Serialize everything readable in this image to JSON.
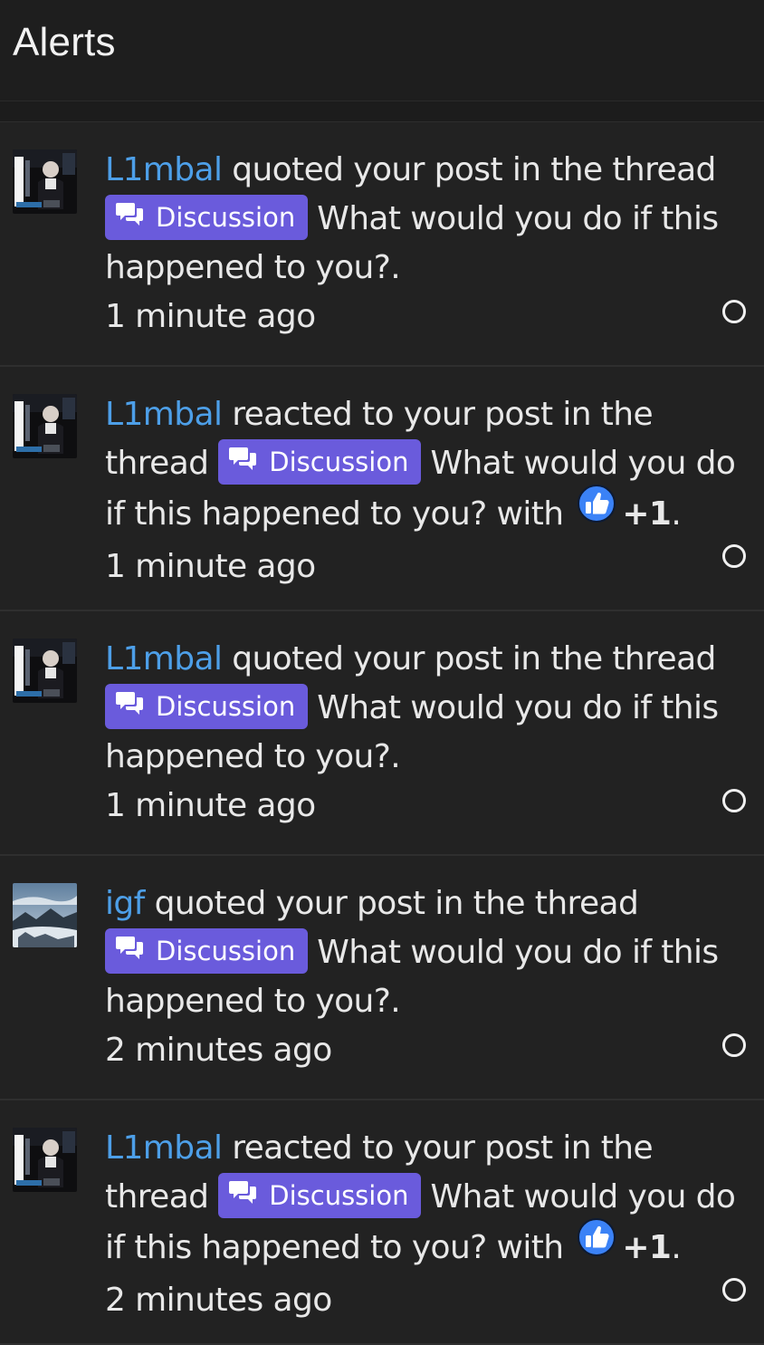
{
  "header": {
    "title": "Alerts"
  },
  "alerts": [
    {
      "user": "L1mbal",
      "action": "quoted your post in the thread",
      "prefix": "Discussion",
      "thread_title": "What would you do if this happened to you?",
      "reaction": "",
      "time": "1 minute ago",
      "avatar": "portrait"
    },
    {
      "user": "L1mbal",
      "action": "reacted to your post in the thread",
      "prefix": "Discussion",
      "thread_title": "What would you do if this happened to you?",
      "reaction": "+1",
      "time": "1 minute ago",
      "avatar": "portrait"
    },
    {
      "user": "L1mbal",
      "action": "quoted your post in the thread",
      "prefix": "Discussion",
      "thread_title": "What would you do if this happened to you?",
      "reaction": "",
      "time": "1 minute ago",
      "avatar": "portrait"
    },
    {
      "user": "igf",
      "action": "quoted your post in the thread",
      "prefix": "Discussion",
      "thread_title": "What would you do if this happened to you?",
      "reaction": "",
      "time": "2 minutes ago",
      "avatar": "landscape"
    },
    {
      "user": "L1mbal",
      "action": "reacted to your post in the thread",
      "prefix": "Discussion",
      "thread_title": "What would you do if this happened to you?",
      "reaction": "+1",
      "time": "2 minutes ago",
      "avatar": "portrait"
    }
  ],
  "icons": {
    "prefix_icon": "discussion-chat-icon",
    "reaction_icon": "thumbs-up-icon",
    "read_toggle_icon": "mark-read-circle-icon"
  },
  "colors": {
    "background": "#1c1c1c",
    "alert_background": "#222222",
    "username": "#4d9fe8",
    "prefix_badge": "#6a5bdc",
    "reaction_blue": "#3b82f6"
  }
}
